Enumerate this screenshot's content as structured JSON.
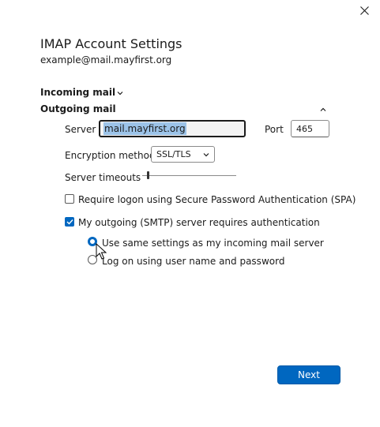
{
  "dialog": {
    "title": "IMAP Account Settings",
    "email": "example@mail.mayfirst.org"
  },
  "icons": {
    "close": "close-icon",
    "expand": "chevron-down-icon",
    "collapse": "chevron-up-icon",
    "dropdown": "chevron-down-icon",
    "check": "checkmark-icon",
    "pointer": "mouse-pointer-icon"
  },
  "sections": {
    "incoming_label": "Incoming mail",
    "outgoing_label": "Outgoing mail"
  },
  "outgoing": {
    "server_label": "Server",
    "server_value": "mail.mayfirst.org",
    "port_label": "Port",
    "port_value": "465",
    "encryption_label": "Encryption method",
    "encryption_value": "SSL/TLS",
    "timeouts_label": "Server timeouts",
    "timeout_level": 0.06,
    "spa_label": "Require logon using Secure Password Authentication (SPA)",
    "spa_checked": false,
    "auth_label": "My outgoing (SMTP) server requires authentication",
    "auth_checked": true,
    "radio_same_label": "Use same settings as my incoming mail server",
    "radio_logon_label": "Log on using user name and password",
    "selected_radio": "same"
  },
  "footer": {
    "next_label": "Next"
  },
  "colors": {
    "accent": "#0067c0",
    "selection": "#9cc3e8",
    "text": "#1b1b1b"
  }
}
